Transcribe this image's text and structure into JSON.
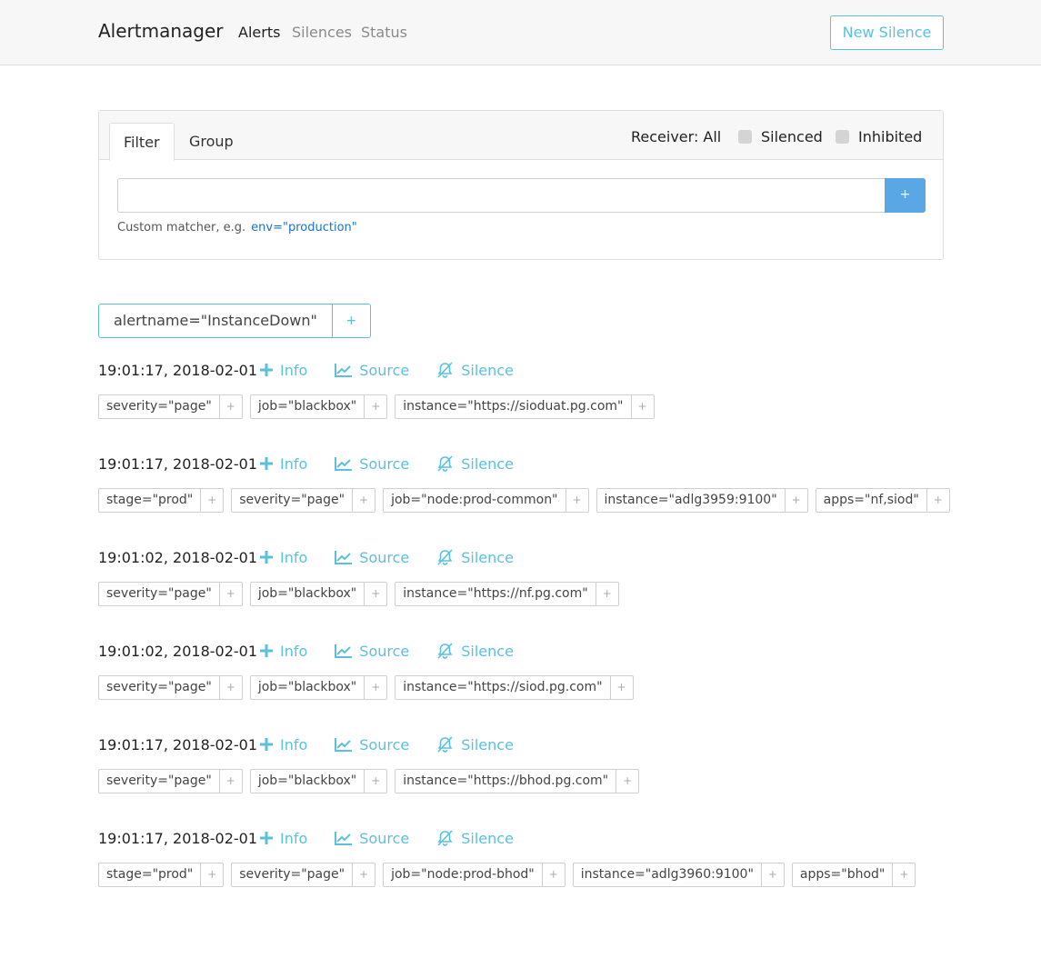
{
  "nav": {
    "brand": "Alertmanager",
    "links": [
      "Alerts",
      "Silences",
      "Status"
    ],
    "new_silence": "New Silence"
  },
  "filter": {
    "tabs": [
      "Filter",
      "Group"
    ],
    "receiver": "Receiver: All",
    "silenced": "Silenced",
    "inhibited": "Inhibited",
    "input_value": "",
    "add": "+",
    "hint": "Custom matcher, e.g.",
    "hint_example": "env=\"production\""
  },
  "group": {
    "label": "alertname=\"InstanceDown\"",
    "add": "+"
  },
  "actions": {
    "info": "Info",
    "source": "Source",
    "silence": "Silence"
  },
  "colors": {
    "accent": "#5bc0de",
    "primary": "#5aa7e6"
  },
  "alerts": [
    {
      "time": "19:01:17, 2018-02-01",
      "labels": [
        "severity=\"page\"",
        "job=\"blackbox\"",
        "instance=\"https://sioduat.pg.com\""
      ]
    },
    {
      "time": "19:01:17, 2018-02-01",
      "labels": [
        "stage=\"prod\"",
        "severity=\"page\"",
        "job=\"node:prod-common\"",
        "instance=\"adlg3959:9100\"",
        "apps=\"nf,siod\""
      ]
    },
    {
      "time": "19:01:02, 2018-02-01",
      "labels": [
        "severity=\"page\"",
        "job=\"blackbox\"",
        "instance=\"https://nf.pg.com\""
      ]
    },
    {
      "time": "19:01:02, 2018-02-01",
      "labels": [
        "severity=\"page\"",
        "job=\"blackbox\"",
        "instance=\"https://siod.pg.com\""
      ]
    },
    {
      "time": "19:01:17, 2018-02-01",
      "labels": [
        "severity=\"page\"",
        "job=\"blackbox\"",
        "instance=\"https://bhod.pg.com\""
      ]
    },
    {
      "time": "19:01:17, 2018-02-01",
      "labels": [
        "stage=\"prod\"",
        "severity=\"page\"",
        "job=\"node:prod-bhod\"",
        "instance=\"adlg3960:9100\"",
        "apps=\"bhod\""
      ]
    }
  ]
}
